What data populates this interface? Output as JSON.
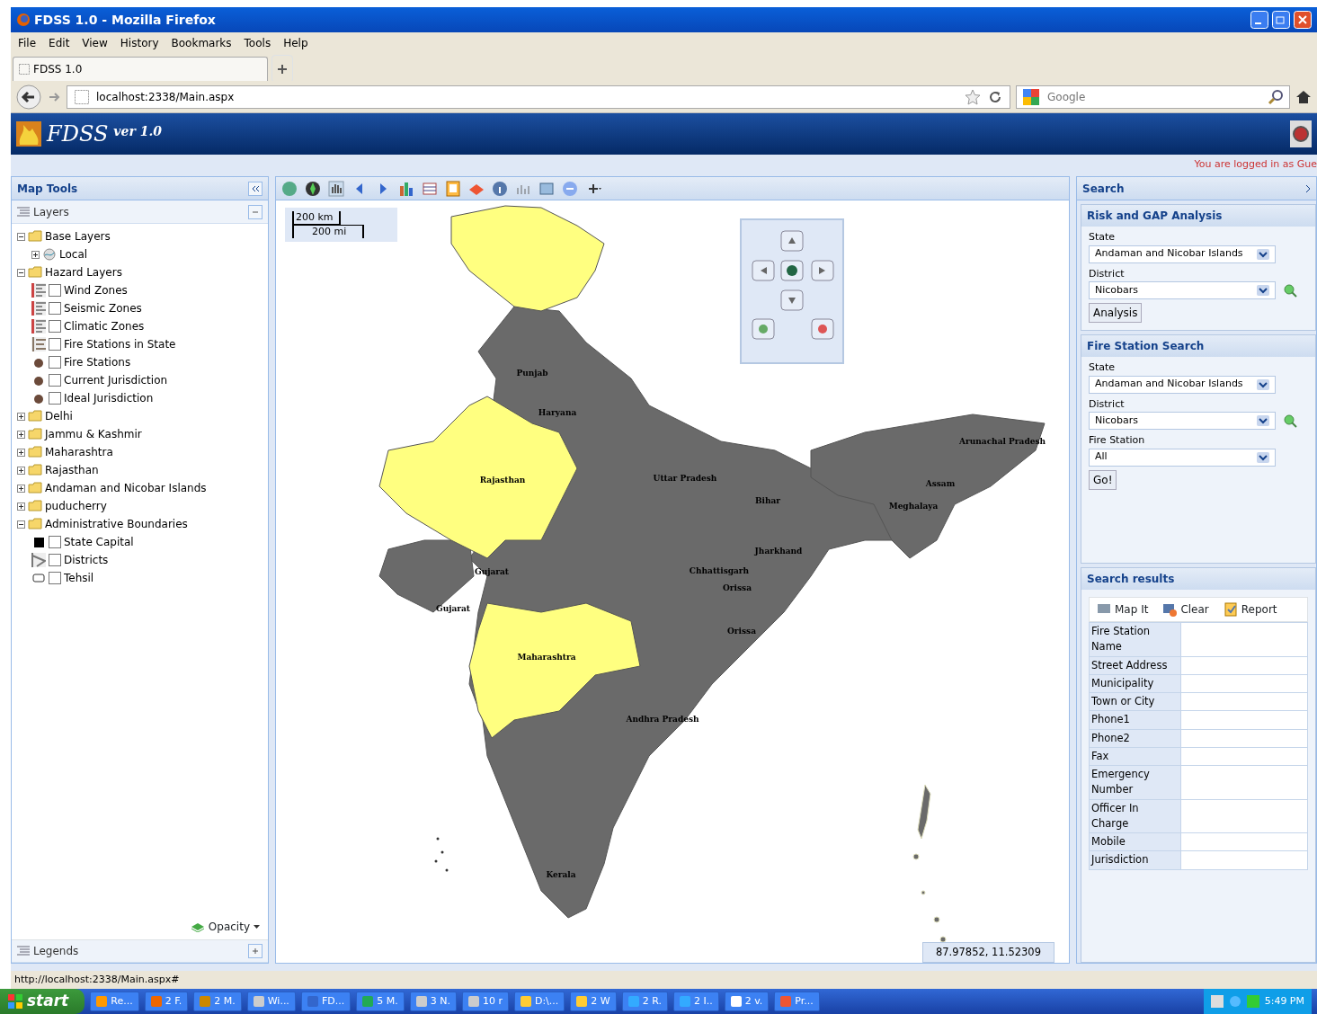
{
  "window": {
    "title": "FDSS 1.0 - Mozilla Firefox"
  },
  "menu": [
    "File",
    "Edit",
    "View",
    "History",
    "Bookmarks",
    "Tools",
    "Help"
  ],
  "tabs": [
    {
      "label": "FDSS 1.0",
      "selected": true
    }
  ],
  "address": {
    "value": "localhost:2338/Main.aspx"
  },
  "web_search": {
    "placeholder": "Google"
  },
  "app_header": {
    "title": "FDSS",
    "version": "ver 1.0",
    "login": "You are logged in as Gue"
  },
  "left_panel": {
    "title": "Map Tools",
    "layers_title": "Layers",
    "tree": [
      {
        "label": "Base Layers",
        "kind": "folder",
        "expanded": true,
        "children": [
          {
            "label": "Local",
            "kind": "service",
            "expanded": false
          }
        ]
      },
      {
        "label": "Hazard Layers",
        "kind": "folder",
        "expanded": true,
        "children": [
          {
            "label": "Wind Zones",
            "kind": "zone",
            "checked": false
          },
          {
            "label": "Seismic Zones",
            "kind": "zone",
            "checked": false
          },
          {
            "label": "Climatic Zones",
            "kind": "zone",
            "checked": false
          },
          {
            "label": "Fire Stations in State",
            "kind": "stations",
            "checked": false
          },
          {
            "label": "Fire Stations",
            "kind": "point",
            "checked": false
          },
          {
            "label": "Current Jurisdiction",
            "kind": "point",
            "checked": false
          },
          {
            "label": "Ideal Jurisdiction",
            "kind": "point",
            "checked": false
          }
        ]
      },
      {
        "label": "Delhi",
        "kind": "folder",
        "expanded": false
      },
      {
        "label": "Jammu & Kashmir",
        "kind": "folder",
        "expanded": false
      },
      {
        "label": "Maharashtra",
        "kind": "folder",
        "expanded": false
      },
      {
        "label": "Rajasthan",
        "kind": "folder",
        "expanded": false
      },
      {
        "label": "Andaman and Nicobar Islands",
        "kind": "folder",
        "expanded": false
      },
      {
        "label": "puducherry",
        "kind": "folder",
        "expanded": false
      },
      {
        "label": "Administrative Boundaries",
        "kind": "folder",
        "expanded": true,
        "children": [
          {
            "label": "State Capital",
            "kind": "capital",
            "checked": false
          },
          {
            "label": "Districts",
            "kind": "district",
            "checked": false
          },
          {
            "label": "Tehsil",
            "kind": "tehsil",
            "checked": false
          }
        ]
      }
    ],
    "opacity": "Opacity",
    "legends_title": "Legends"
  },
  "map": {
    "scale": [
      "200 km",
      "200 mi"
    ],
    "coordinates": "87.97852, 11.52309",
    "labels": [
      "Punjab",
      "Haryana",
      "Rajasthan",
      "Uttar Pradesh",
      "Bihar",
      "Arunachal Pradesh",
      "Assam",
      "Meghalaya",
      "Gujarat",
      "Gujarat",
      "Jharkhand",
      "Chhattisgarh",
      "Orissa",
      "Orissa",
      "Maharashtra",
      "Andhra Pradesh",
      "Kerala"
    ],
    "regions": [
      {
        "kind": "mainland",
        "highlighted": false
      },
      {
        "kind": "northeast",
        "highlighted": false
      },
      {
        "kind": "kutch",
        "highlighted": false
      },
      {
        "kind": "kashmir",
        "highlighted": true
      },
      {
        "kind": "rajasthan",
        "highlighted": true
      },
      {
        "kind": "maharashtra",
        "highlighted": true
      }
    ]
  },
  "right_panel": {
    "title": "Search",
    "risk": {
      "title": "Risk and GAP Analysis",
      "fields": [
        {
          "label": "State",
          "value": "Andaman and Nicobar Islands"
        },
        {
          "label": "District",
          "value": "Nicobars"
        }
      ],
      "button": "Analysis"
    },
    "fire_search": {
      "title": "Fire Station Search",
      "fields": [
        {
          "label": "State",
          "value": "Andaman and Nicobar Islands"
        },
        {
          "label": "District",
          "value": "Nicobars"
        },
        {
          "label": "Fire Station",
          "value": "All"
        }
      ],
      "button": "Go!"
    },
    "results": {
      "title": "Search results",
      "actions": [
        "Map It",
        "Clear",
        "Report"
      ],
      "rows": [
        "Fire Station Name",
        "Street Address",
        "Municipality",
        "Town or City",
        "Phone1",
        "Phone2",
        "Fax",
        "Emergency Number",
        "Officer In Charge",
        "Mobile",
        "Jurisdiction"
      ]
    }
  },
  "status_bar": "http://localhost:2338/Main.aspx#",
  "taskbar": {
    "start": "start",
    "items": [
      "Re...",
      "2 F.",
      "2 M.",
      "Wi...",
      "FD...",
      "5 M.",
      "3 N.",
      "10 r",
      "D:\\...",
      "2 W",
      "2 R.",
      "2 I..",
      "2 v.",
      "Pr..."
    ],
    "time": "5:49 PM"
  }
}
